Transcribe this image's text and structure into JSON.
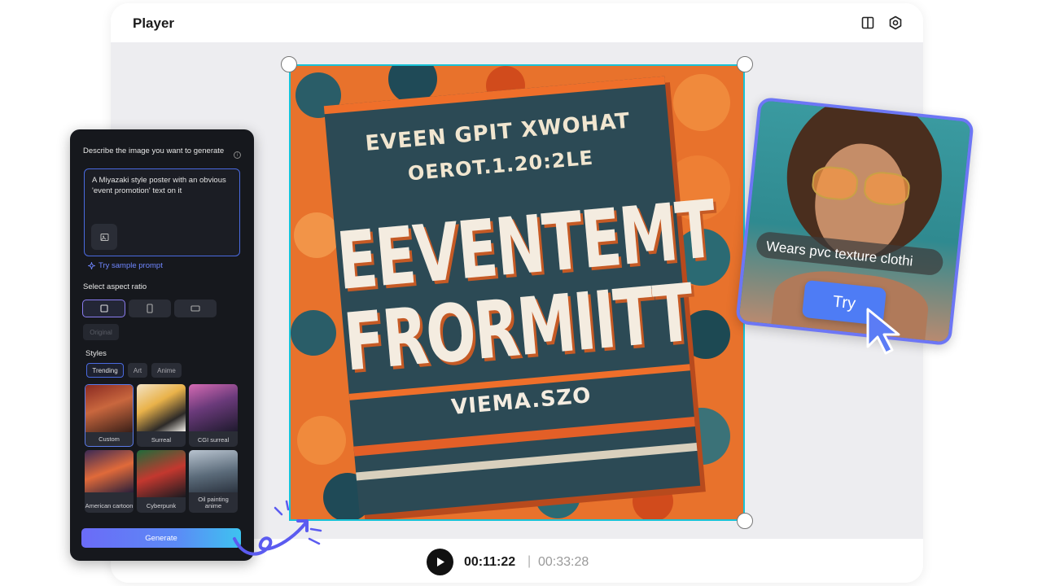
{
  "player": {
    "title": "Player",
    "current_time": "00:11:22",
    "separator": "|",
    "total_time": "00:33:28"
  },
  "poster": {
    "line1": "EVEEN GPIT XWOHAT",
    "line2": "OEROT.1.20:2LE",
    "line3": "EEVENTEMT",
    "line4": "FRORMIITT",
    "line5": "VIEMA.SZO"
  },
  "generator": {
    "prompt_heading": "Describe the image you want to generate",
    "prompt_value": "A Miyazaki style poster with an obvious 'event promotion' text on it",
    "sample_link": "Try sample prompt",
    "aspect_heading": "Select aspect ratio",
    "original_label": "Original",
    "styles_heading": "Styles",
    "style_tabs": [
      "Trending",
      "Art",
      "Anime"
    ],
    "style_cards": [
      "Custom",
      "Surreal",
      "CGI surreal",
      "American cartoon",
      "Cyberpunk",
      "Oil painting anime"
    ],
    "generate_label": "Generate"
  },
  "try_card": {
    "caption": "Wears pvc texture clothi",
    "button_label": "Try"
  },
  "colors": {
    "accent": "#6d76f5",
    "selection": "#19c2d6",
    "panel_bg": "#16181d"
  }
}
